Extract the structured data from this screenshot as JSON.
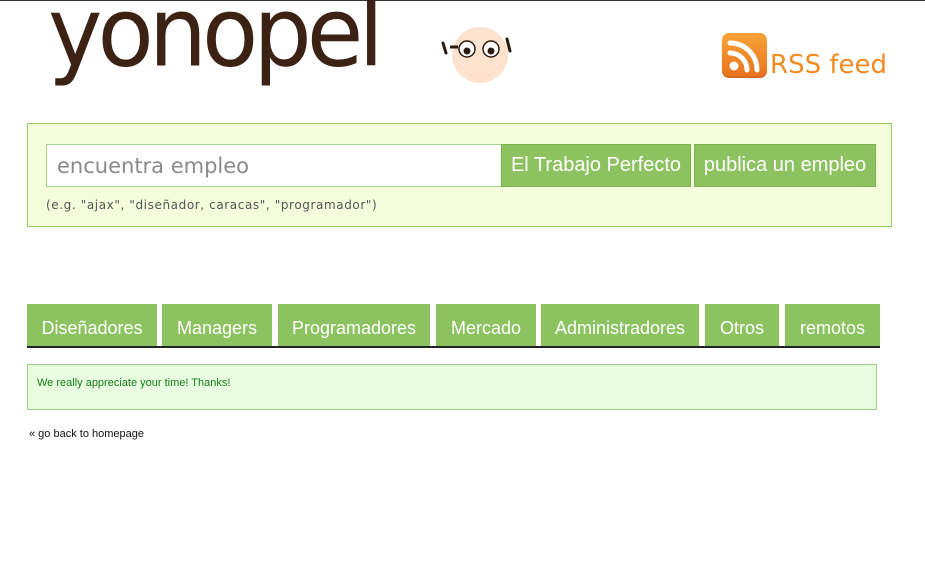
{
  "header": {
    "logo_text": "yonopel",
    "rss_label": "RSS feed"
  },
  "search": {
    "placeholder": "encuentra empleo",
    "value": "",
    "search_button": "El Trabajo Perfecto",
    "publish_button": "publica un empleo",
    "hint": "(e.g. \"ajax\", \"diseñador, caracas\", \"programador\")"
  },
  "tabs": [
    {
      "label": "Diseñadores"
    },
    {
      "label": "Managers"
    },
    {
      "label": "Programadores"
    },
    {
      "label": "Mercado"
    },
    {
      "label": "Administradores"
    },
    {
      "label": "Otros"
    },
    {
      "label": "remotos"
    }
  ],
  "notice": {
    "message": "We really appreciate your time! Thanks!"
  },
  "footer": {
    "back_link": "« go back to homepage"
  },
  "colors": {
    "brand_green": "#8cc260",
    "panel_bg": "#f4fcdc",
    "notice_bg": "#e8fde0",
    "rss_orange": "#f08c22",
    "logo_brown": "#3b2214"
  },
  "icons": {
    "rss": "rss-icon",
    "logo_face": "face-icon"
  }
}
